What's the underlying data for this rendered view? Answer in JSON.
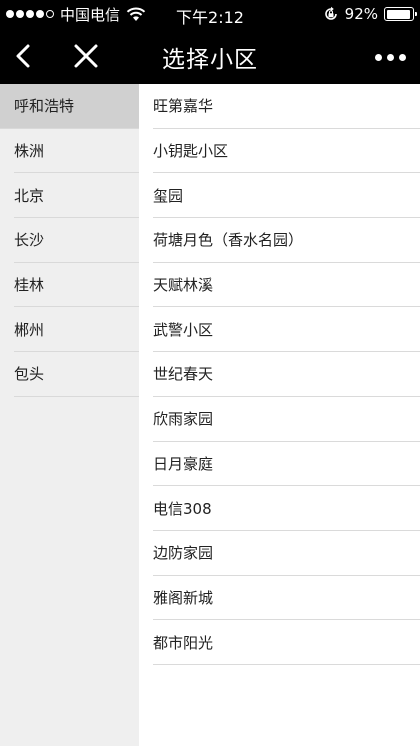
{
  "status_bar": {
    "carrier": "中国电信",
    "time": "下午2:12",
    "battery_percent": "92%",
    "battery_level": 0.92
  },
  "nav": {
    "title": "选择小区"
  },
  "sidebar": {
    "items": [
      {
        "label": "呼和浩特",
        "active": true
      },
      {
        "label": "株洲"
      },
      {
        "label": "北京"
      },
      {
        "label": "长沙"
      },
      {
        "label": "桂林"
      },
      {
        "label": "郴州"
      },
      {
        "label": "包头"
      }
    ]
  },
  "communities": {
    "items": [
      {
        "label": "旺第嘉华"
      },
      {
        "label": "小钥匙小区"
      },
      {
        "label": "玺园"
      },
      {
        "label": "荷塘月色（香水名园）"
      },
      {
        "label": "天赋林溪"
      },
      {
        "label": "武警小区"
      },
      {
        "label": "世纪春天"
      },
      {
        "label": "欣雨家园"
      },
      {
        "label": "日月豪庭"
      },
      {
        "label": "电信308"
      },
      {
        "label": "边防家园"
      },
      {
        "label": "雅阁新城"
      },
      {
        "label": "都市阳光"
      }
    ]
  }
}
